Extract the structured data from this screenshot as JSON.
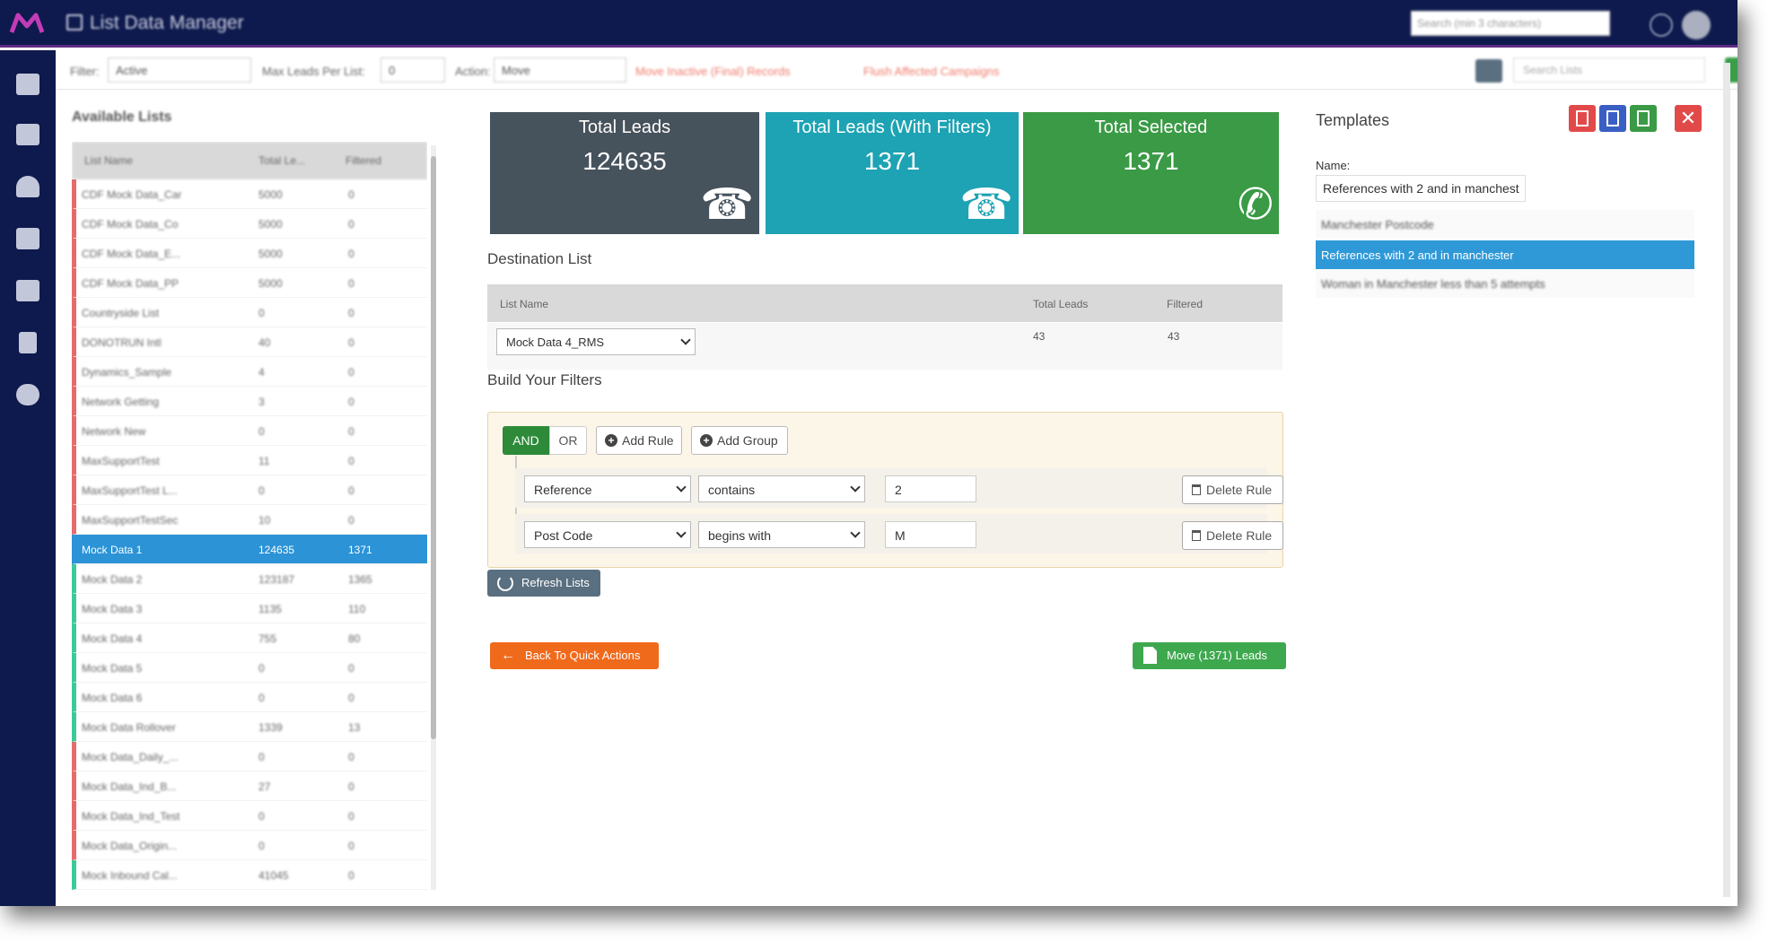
{
  "header": {
    "app_title": "List Data Manager",
    "search_placeholder": "Search (min 3 characters)"
  },
  "toolbar": {
    "filter_label": "Filter:",
    "filter_value": "Active",
    "max_leads_label": "Max Leads Per List:",
    "max_leads_value": "0",
    "action_label": "Action:",
    "action_value": "Move",
    "option_inactive": "Move Inactive (Final) Records",
    "option_flush": "Flush Affected Campaigns",
    "search_placeholder": "Search Lists"
  },
  "available_lists": {
    "title": "Available Lists",
    "columns": [
      "List Name",
      "Total Le...",
      "Filtered"
    ],
    "rows": [
      {
        "name": "CDF Mock Data_Car",
        "total": "5000",
        "filtered": "0",
        "color": "red"
      },
      {
        "name": "CDF Mock Data_Co",
        "total": "5000",
        "filtered": "0",
        "color": "red"
      },
      {
        "name": "CDF Mock Data_E...",
        "total": "5000",
        "filtered": "0",
        "color": "red"
      },
      {
        "name": "CDF Mock Data_PP",
        "total": "5000",
        "filtered": "0",
        "color": "red"
      },
      {
        "name": "Countryside List",
        "total": "0",
        "filtered": "0",
        "color": "red"
      },
      {
        "name": "DONOTRUN Intl",
        "total": "40",
        "filtered": "0",
        "color": "red"
      },
      {
        "name": "Dynamics_Sample",
        "total": "4",
        "filtered": "0",
        "color": "red"
      },
      {
        "name": "Network Getting",
        "total": "3",
        "filtered": "0",
        "color": "red"
      },
      {
        "name": "Network New",
        "total": "0",
        "filtered": "0",
        "color": "red"
      },
      {
        "name": "MaxSupportTest",
        "total": "11",
        "filtered": "0",
        "color": "red"
      },
      {
        "name": "MaxSupportTest L...",
        "total": "0",
        "filtered": "0",
        "color": "red"
      },
      {
        "name": "MaxSupportTestSec",
        "total": "10",
        "filtered": "0",
        "color": "red"
      },
      {
        "name": "Mock Data 1",
        "total": "124635",
        "filtered": "1371",
        "color": "selected"
      },
      {
        "name": "Mock Data 2",
        "total": "123187",
        "filtered": "1365",
        "color": "green"
      },
      {
        "name": "Mock Data 3",
        "total": "1135",
        "filtered": "110",
        "color": "green"
      },
      {
        "name": "Mock Data 4",
        "total": "755",
        "filtered": "80",
        "color": "green"
      },
      {
        "name": "Mock Data 5",
        "total": "0",
        "filtered": "0",
        "color": "green"
      },
      {
        "name": "Mock Data 6",
        "total": "0",
        "filtered": "0",
        "color": "green"
      },
      {
        "name": "Mock Data Rollover",
        "total": "1339",
        "filtered": "13",
        "color": "green"
      },
      {
        "name": "Mock Data_Daily_...",
        "total": "0",
        "filtered": "0",
        "color": "red"
      },
      {
        "name": "Mock Data_Ind_B...",
        "total": "27",
        "filtered": "0",
        "color": "red"
      },
      {
        "name": "Mock Data_Ind_Test",
        "total": "0",
        "filtered": "0",
        "color": "red"
      },
      {
        "name": "Mock Data_Origin...",
        "total": "0",
        "filtered": "0",
        "color": "red"
      },
      {
        "name": "Mock Inbound Cal...",
        "total": "41045",
        "filtered": "0",
        "color": "green"
      }
    ]
  },
  "stats": {
    "total_leads": {
      "label": "Total Leads",
      "value": "124635"
    },
    "total_filtered": {
      "label": "Total Leads (With Filters)",
      "value": "1371"
    },
    "total_selected": {
      "label": "Total Selected",
      "value": "1371"
    }
  },
  "destination": {
    "title": "Destination List",
    "columns": [
      "List Name",
      "Total Leads",
      "Filtered"
    ],
    "selected_list": "Mock Data 4_RMS",
    "total_leads": "43",
    "filtered": "43"
  },
  "filters": {
    "title": "Build Your Filters",
    "and_label": "AND",
    "or_label": "OR",
    "add_rule_label": "Add Rule",
    "add_group_label": "Add Group",
    "rules": [
      {
        "field": "Reference",
        "operator": "contains",
        "value": "2",
        "delete_label": "Delete Rule"
      },
      {
        "field": "Post Code",
        "operator": "begins with",
        "value": "M",
        "delete_label": "Delete Rule"
      }
    ],
    "refresh_label": "Refresh Lists"
  },
  "actions": {
    "back_label": "Back To Quick Actions",
    "move_label": "Move (1371) Leads"
  },
  "templates": {
    "title": "Templates",
    "name_label": "Name:",
    "name_value": "References with 2 and in manchest",
    "items": [
      "Manchester Postcode",
      "References with 2 and in manchester",
      "Woman in Manchester less than 5 attempts"
    ]
  },
  "colors": {
    "nav": "#0e1a4d",
    "selected": "#2b93d6",
    "card_dark": "#46525c",
    "card_teal": "#1da3b3",
    "card_green": "#3a9a45",
    "orange": "#f06a1c"
  }
}
